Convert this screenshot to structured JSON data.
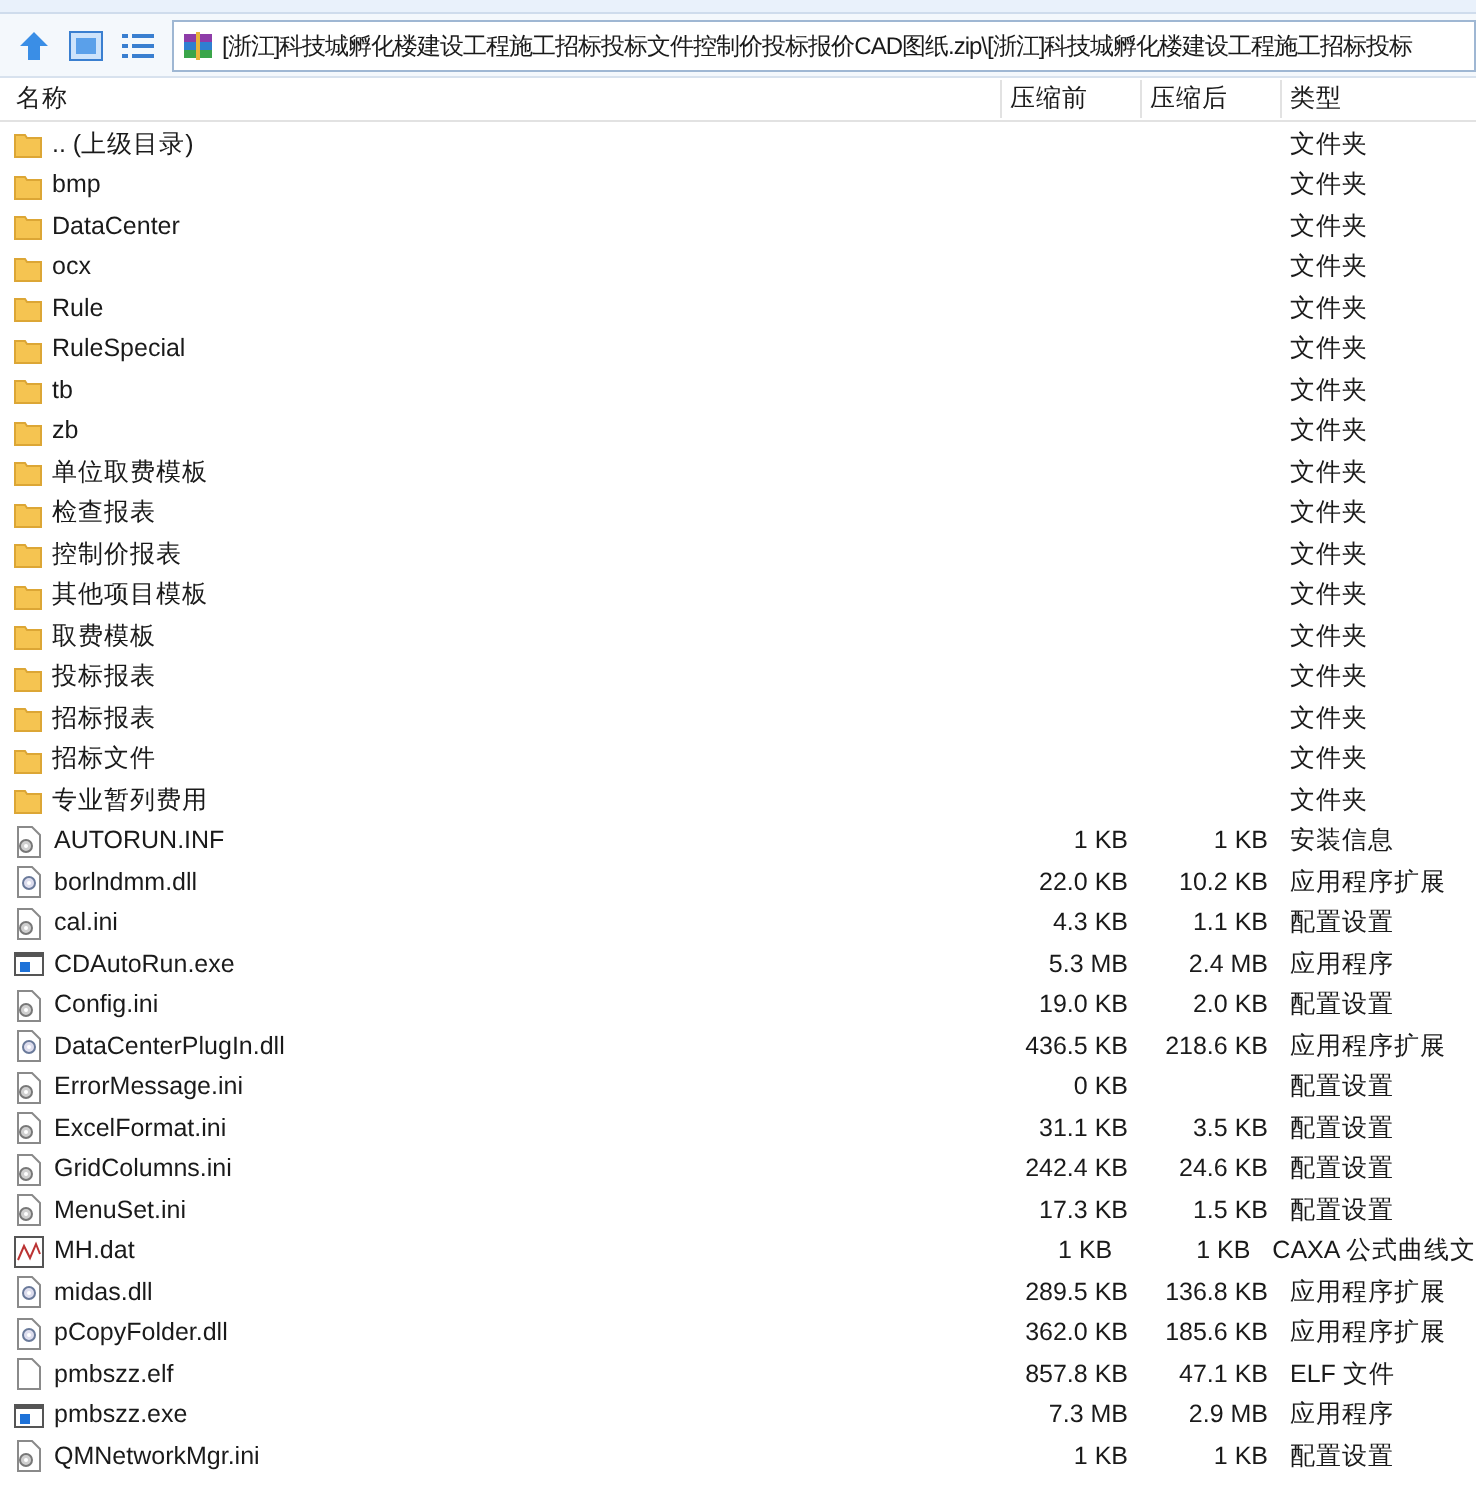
{
  "address": "[浙江]科技城孵化楼建设工程施工招标投标文件控制价投标报价CAD图纸.zip\\[浙江]科技城孵化楼建设工程施工招标投标",
  "columns": [
    "名称",
    "压缩前",
    "压缩后",
    "类型"
  ],
  "rows": [
    {
      "kind": "folder",
      "name": ".. (上级目录)",
      "size": "",
      "packed": "",
      "type": "文件夹"
    },
    {
      "kind": "folder",
      "name": "bmp",
      "size": "",
      "packed": "",
      "type": "文件夹"
    },
    {
      "kind": "folder",
      "name": "DataCenter",
      "size": "",
      "packed": "",
      "type": "文件夹"
    },
    {
      "kind": "folder",
      "name": "ocx",
      "size": "",
      "packed": "",
      "type": "文件夹"
    },
    {
      "kind": "folder",
      "name": "Rule",
      "size": "",
      "packed": "",
      "type": "文件夹"
    },
    {
      "kind": "folder",
      "name": "RuleSpecial",
      "size": "",
      "packed": "",
      "type": "文件夹"
    },
    {
      "kind": "folder",
      "name": "tb",
      "size": "",
      "packed": "",
      "type": "文件夹"
    },
    {
      "kind": "folder",
      "name": "zb",
      "size": "",
      "packed": "",
      "type": "文件夹"
    },
    {
      "kind": "folder",
      "name": "单位取费模板",
      "size": "",
      "packed": "",
      "type": "文件夹"
    },
    {
      "kind": "folder",
      "name": "检查报表",
      "size": "",
      "packed": "",
      "type": "文件夹"
    },
    {
      "kind": "folder",
      "name": "控制价报表",
      "size": "",
      "packed": "",
      "type": "文件夹"
    },
    {
      "kind": "folder",
      "name": "其他项目模板",
      "size": "",
      "packed": "",
      "type": "文件夹"
    },
    {
      "kind": "folder",
      "name": "取费模板",
      "size": "",
      "packed": "",
      "type": "文件夹"
    },
    {
      "kind": "folder",
      "name": "投标报表",
      "size": "",
      "packed": "",
      "type": "文件夹"
    },
    {
      "kind": "folder",
      "name": "招标报表",
      "size": "",
      "packed": "",
      "type": "文件夹"
    },
    {
      "kind": "folder",
      "name": "招标文件",
      "size": "",
      "packed": "",
      "type": "文件夹"
    },
    {
      "kind": "folder",
      "name": "专业暂列费用",
      "size": "",
      "packed": "",
      "type": "文件夹"
    },
    {
      "kind": "config",
      "name": "AUTORUN.INF",
      "size": "1 KB",
      "packed": "1 KB",
      "type": "安装信息"
    },
    {
      "kind": "dll",
      "name": "borlndmm.dll",
      "size": "22.0 KB",
      "packed": "10.2 KB",
      "type": "应用程序扩展"
    },
    {
      "kind": "config",
      "name": "cal.ini",
      "size": "4.3 KB",
      "packed": "1.1 KB",
      "type": "配置设置"
    },
    {
      "kind": "exe",
      "name": "CDAutoRun.exe",
      "size": "5.3 MB",
      "packed": "2.4 MB",
      "type": "应用程序"
    },
    {
      "kind": "config",
      "name": "Config.ini",
      "size": "19.0 KB",
      "packed": "2.0 KB",
      "type": "配置设置"
    },
    {
      "kind": "dll",
      "name": "DataCenterPlugIn.dll",
      "size": "436.5 KB",
      "packed": "218.6 KB",
      "type": "应用程序扩展"
    },
    {
      "kind": "config",
      "name": "ErrorMessage.ini",
      "size": "0 KB",
      "packed": "",
      "type": "配置设置"
    },
    {
      "kind": "config",
      "name": "ExcelFormat.ini",
      "size": "31.1 KB",
      "packed": "3.5 KB",
      "type": "配置设置"
    },
    {
      "kind": "config",
      "name": "GridColumns.ini",
      "size": "242.4 KB",
      "packed": "24.6 KB",
      "type": "配置设置"
    },
    {
      "kind": "config",
      "name": "MenuSet.ini",
      "size": "17.3 KB",
      "packed": "1.5 KB",
      "type": "配置设置"
    },
    {
      "kind": "chart",
      "name": "MH.dat",
      "size": "1 KB",
      "packed": "1 KB",
      "type": "CAXA 公式曲线文"
    },
    {
      "kind": "dll",
      "name": "midas.dll",
      "size": "289.5 KB",
      "packed": "136.8 KB",
      "type": "应用程序扩展"
    },
    {
      "kind": "dll",
      "name": "pCopyFolder.dll",
      "size": "362.0 KB",
      "packed": "185.6 KB",
      "type": "应用程序扩展"
    },
    {
      "kind": "plain",
      "name": "pmbszz.elf",
      "size": "857.8 KB",
      "packed": "47.1 KB",
      "type": "ELF 文件"
    },
    {
      "kind": "exe",
      "name": "pmbszz.exe",
      "size": "7.3 MB",
      "packed": "2.9 MB",
      "type": "应用程序"
    },
    {
      "kind": "config",
      "name": "QMNetworkMgr.ini",
      "size": "1 KB",
      "packed": "1 KB",
      "type": "配置设置"
    }
  ]
}
